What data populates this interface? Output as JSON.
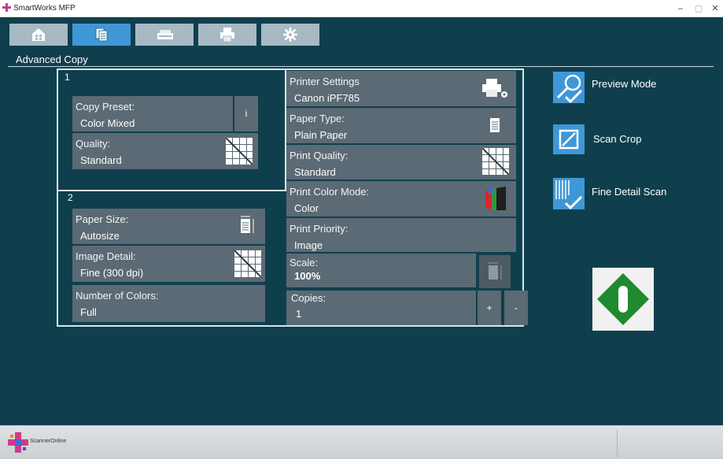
{
  "window": {
    "title": "SmartWorks MFP",
    "controls": [
      "–",
      "▢",
      "✕"
    ]
  },
  "tabs": [
    {
      "name": "home",
      "icon": "home-icon",
      "active": false
    },
    {
      "name": "copy",
      "icon": "copy-icon",
      "active": true
    },
    {
      "name": "scan",
      "icon": "scanner-icon",
      "active": false
    },
    {
      "name": "print",
      "icon": "printer-icon",
      "active": false
    },
    {
      "name": "settings",
      "icon": "gear-icon",
      "active": false
    }
  ],
  "section": {
    "title": "Advanced Copy"
  },
  "group1": {
    "number": "1",
    "copy_preset": {
      "label": "Copy Preset:",
      "value": "Color Mixed",
      "info_button": "i"
    },
    "quality": {
      "label": "Quality:",
      "value": "Standard"
    }
  },
  "group2": {
    "number": "2",
    "paper_size": {
      "label": "Paper Size:",
      "value": "Autosize"
    },
    "image_detail": {
      "label": "Image Detail:",
      "value": "Fine (300 dpi)"
    },
    "number_of_colors": {
      "label": "Number of Colors:",
      "value": "Full"
    }
  },
  "printer": {
    "printer_settings": {
      "label": "Printer Settings",
      "value": "Canon iPF785"
    },
    "paper_type": {
      "label": "Paper Type:",
      "value": "Plain Paper"
    },
    "print_quality": {
      "label": "Print Quality:",
      "value": "Standard"
    },
    "print_color_mode": {
      "label": "Print Color Mode:",
      "value": "Color"
    },
    "print_priority": {
      "label": "Print Priority:",
      "value": "Image"
    },
    "scale": {
      "label": "Scale:",
      "value": "100%"
    },
    "copies": {
      "label": "Copies:",
      "value": "1",
      "plus": "+",
      "minus": "-"
    }
  },
  "options": [
    {
      "label": "Preview Mode",
      "icon": "preview-check-icon"
    },
    {
      "label": "Scan Crop",
      "icon": "crop-icon"
    },
    {
      "label": "Fine Detail Scan",
      "icon": "fine-detail-check-icon"
    }
  ],
  "start": {
    "icon": "start-icon",
    "color": "#1f8a2e"
  },
  "footer": {
    "logo_text": "ScannerOnline"
  },
  "colors": {
    "background": "#0f3f4d",
    "panel": "#5b6a74",
    "accent": "#3f97d6",
    "tab_inactive": "#a7bac4"
  }
}
